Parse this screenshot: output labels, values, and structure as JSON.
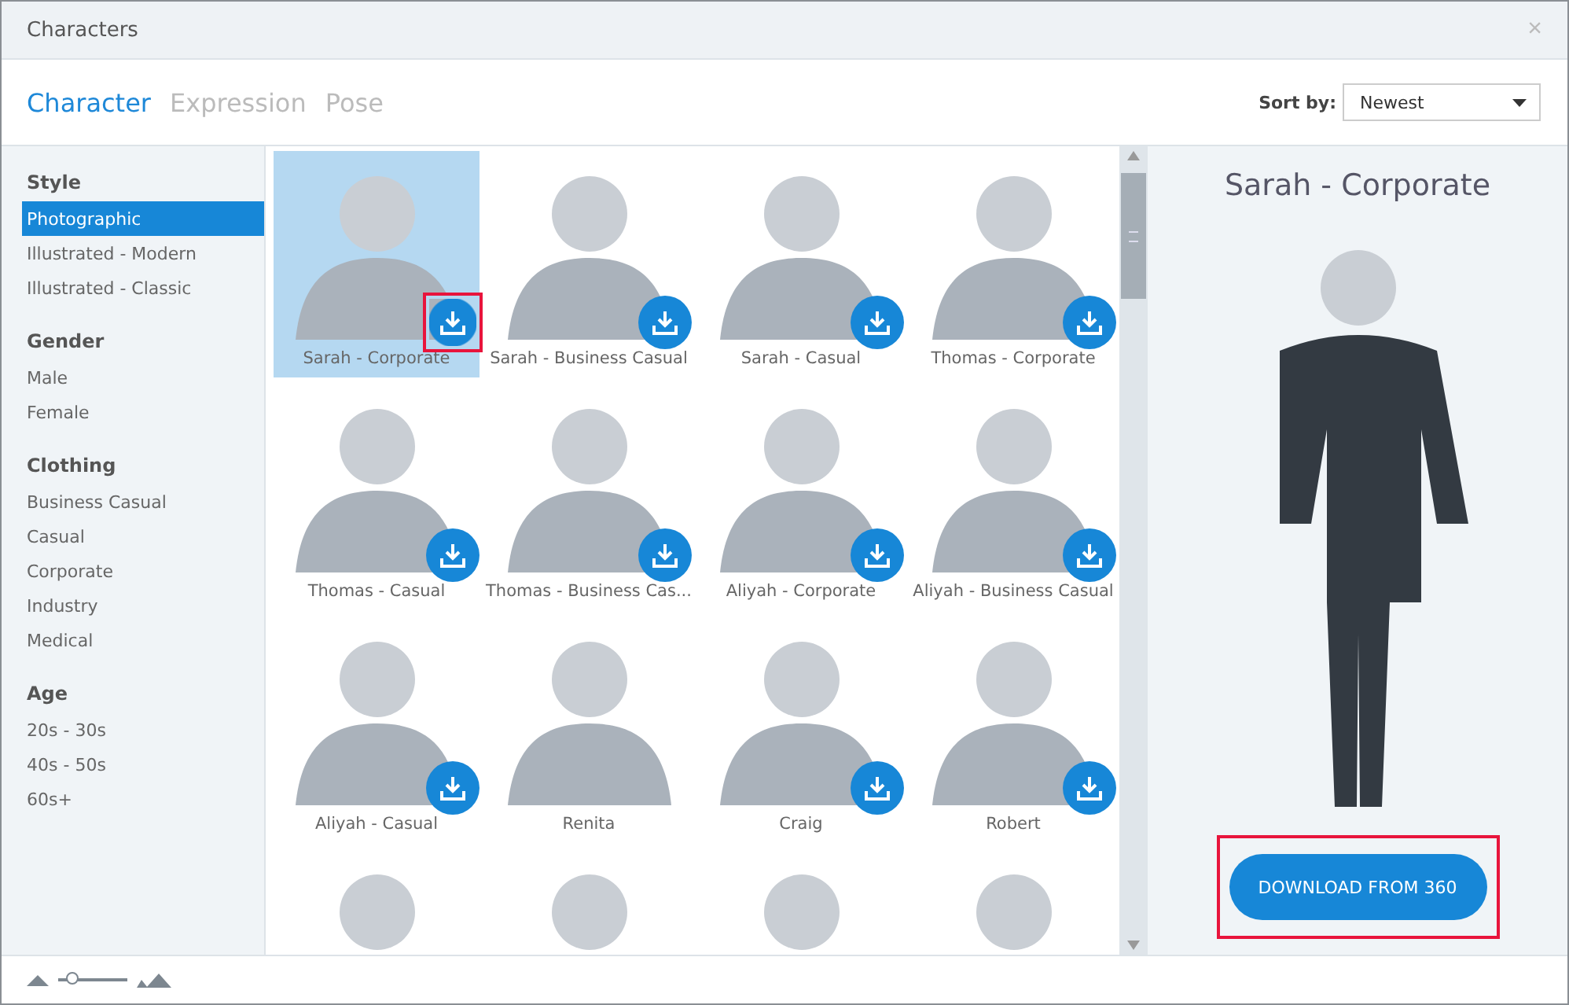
{
  "window": {
    "title": "Characters",
    "close": "×"
  },
  "tabs": [
    {
      "label": "Character",
      "selected": true
    },
    {
      "label": "Expression",
      "selected": false
    },
    {
      "label": "Pose",
      "selected": false
    }
  ],
  "sort": {
    "label": "Sort by:",
    "value": "Newest"
  },
  "sidebar": {
    "groups": [
      {
        "heading": "Style",
        "items": [
          {
            "label": "Photographic",
            "selected": true
          },
          {
            "label": "Illustrated - Modern",
            "selected": false
          },
          {
            "label": "Illustrated - Classic",
            "selected": false
          }
        ]
      },
      {
        "heading": "Gender",
        "items": [
          {
            "label": "Male",
            "selected": false
          },
          {
            "label": "Female",
            "selected": false
          }
        ]
      },
      {
        "heading": "Clothing",
        "items": [
          {
            "label": "Business Casual",
            "selected": false
          },
          {
            "label": "Casual",
            "selected": false
          },
          {
            "label": "Corporate",
            "selected": false
          },
          {
            "label": "Industry",
            "selected": false
          },
          {
            "label": "Medical",
            "selected": false
          }
        ]
      },
      {
        "heading": "Age",
        "items": [
          {
            "label": "20s - 30s",
            "selected": false
          },
          {
            "label": "40s - 50s",
            "selected": false
          },
          {
            "label": "60s+",
            "selected": false
          }
        ]
      }
    ]
  },
  "characters": [
    {
      "label": "Sarah - Corporate",
      "selected": true,
      "downloadable": true,
      "highlighted": true
    },
    {
      "label": "Sarah - Business Casual",
      "selected": false,
      "downloadable": true,
      "highlighted": false
    },
    {
      "label": "Sarah - Casual",
      "selected": false,
      "downloadable": true,
      "highlighted": false
    },
    {
      "label": "Thomas - Corporate",
      "selected": false,
      "downloadable": true,
      "highlighted": false
    },
    {
      "label": "Thomas - Casual",
      "selected": false,
      "downloadable": true,
      "highlighted": false
    },
    {
      "label": "Thomas - Business Cas...",
      "selected": false,
      "downloadable": true,
      "highlighted": false
    },
    {
      "label": "Aliyah - Corporate",
      "selected": false,
      "downloadable": true,
      "highlighted": false
    },
    {
      "label": "Aliyah - Business Casual",
      "selected": false,
      "downloadable": true,
      "highlighted": false
    },
    {
      "label": "Aliyah - Casual",
      "selected": false,
      "downloadable": true,
      "highlighted": false
    },
    {
      "label": "Renita",
      "selected": false,
      "downloadable": false,
      "highlighted": false
    },
    {
      "label": "Craig",
      "selected": false,
      "downloadable": true,
      "highlighted": false
    },
    {
      "label": "Robert",
      "selected": false,
      "downloadable": true,
      "highlighted": false
    },
    {
      "selected": false
    },
    {
      "selected": false
    },
    {
      "selected": false
    },
    {
      "selected": false
    }
  ],
  "preview": {
    "title": "Sarah - Corporate",
    "button": "DOWNLOAD FROM 360",
    "button_highlighted": true
  },
  "zoom_slider": {
    "level": 0.2
  }
}
